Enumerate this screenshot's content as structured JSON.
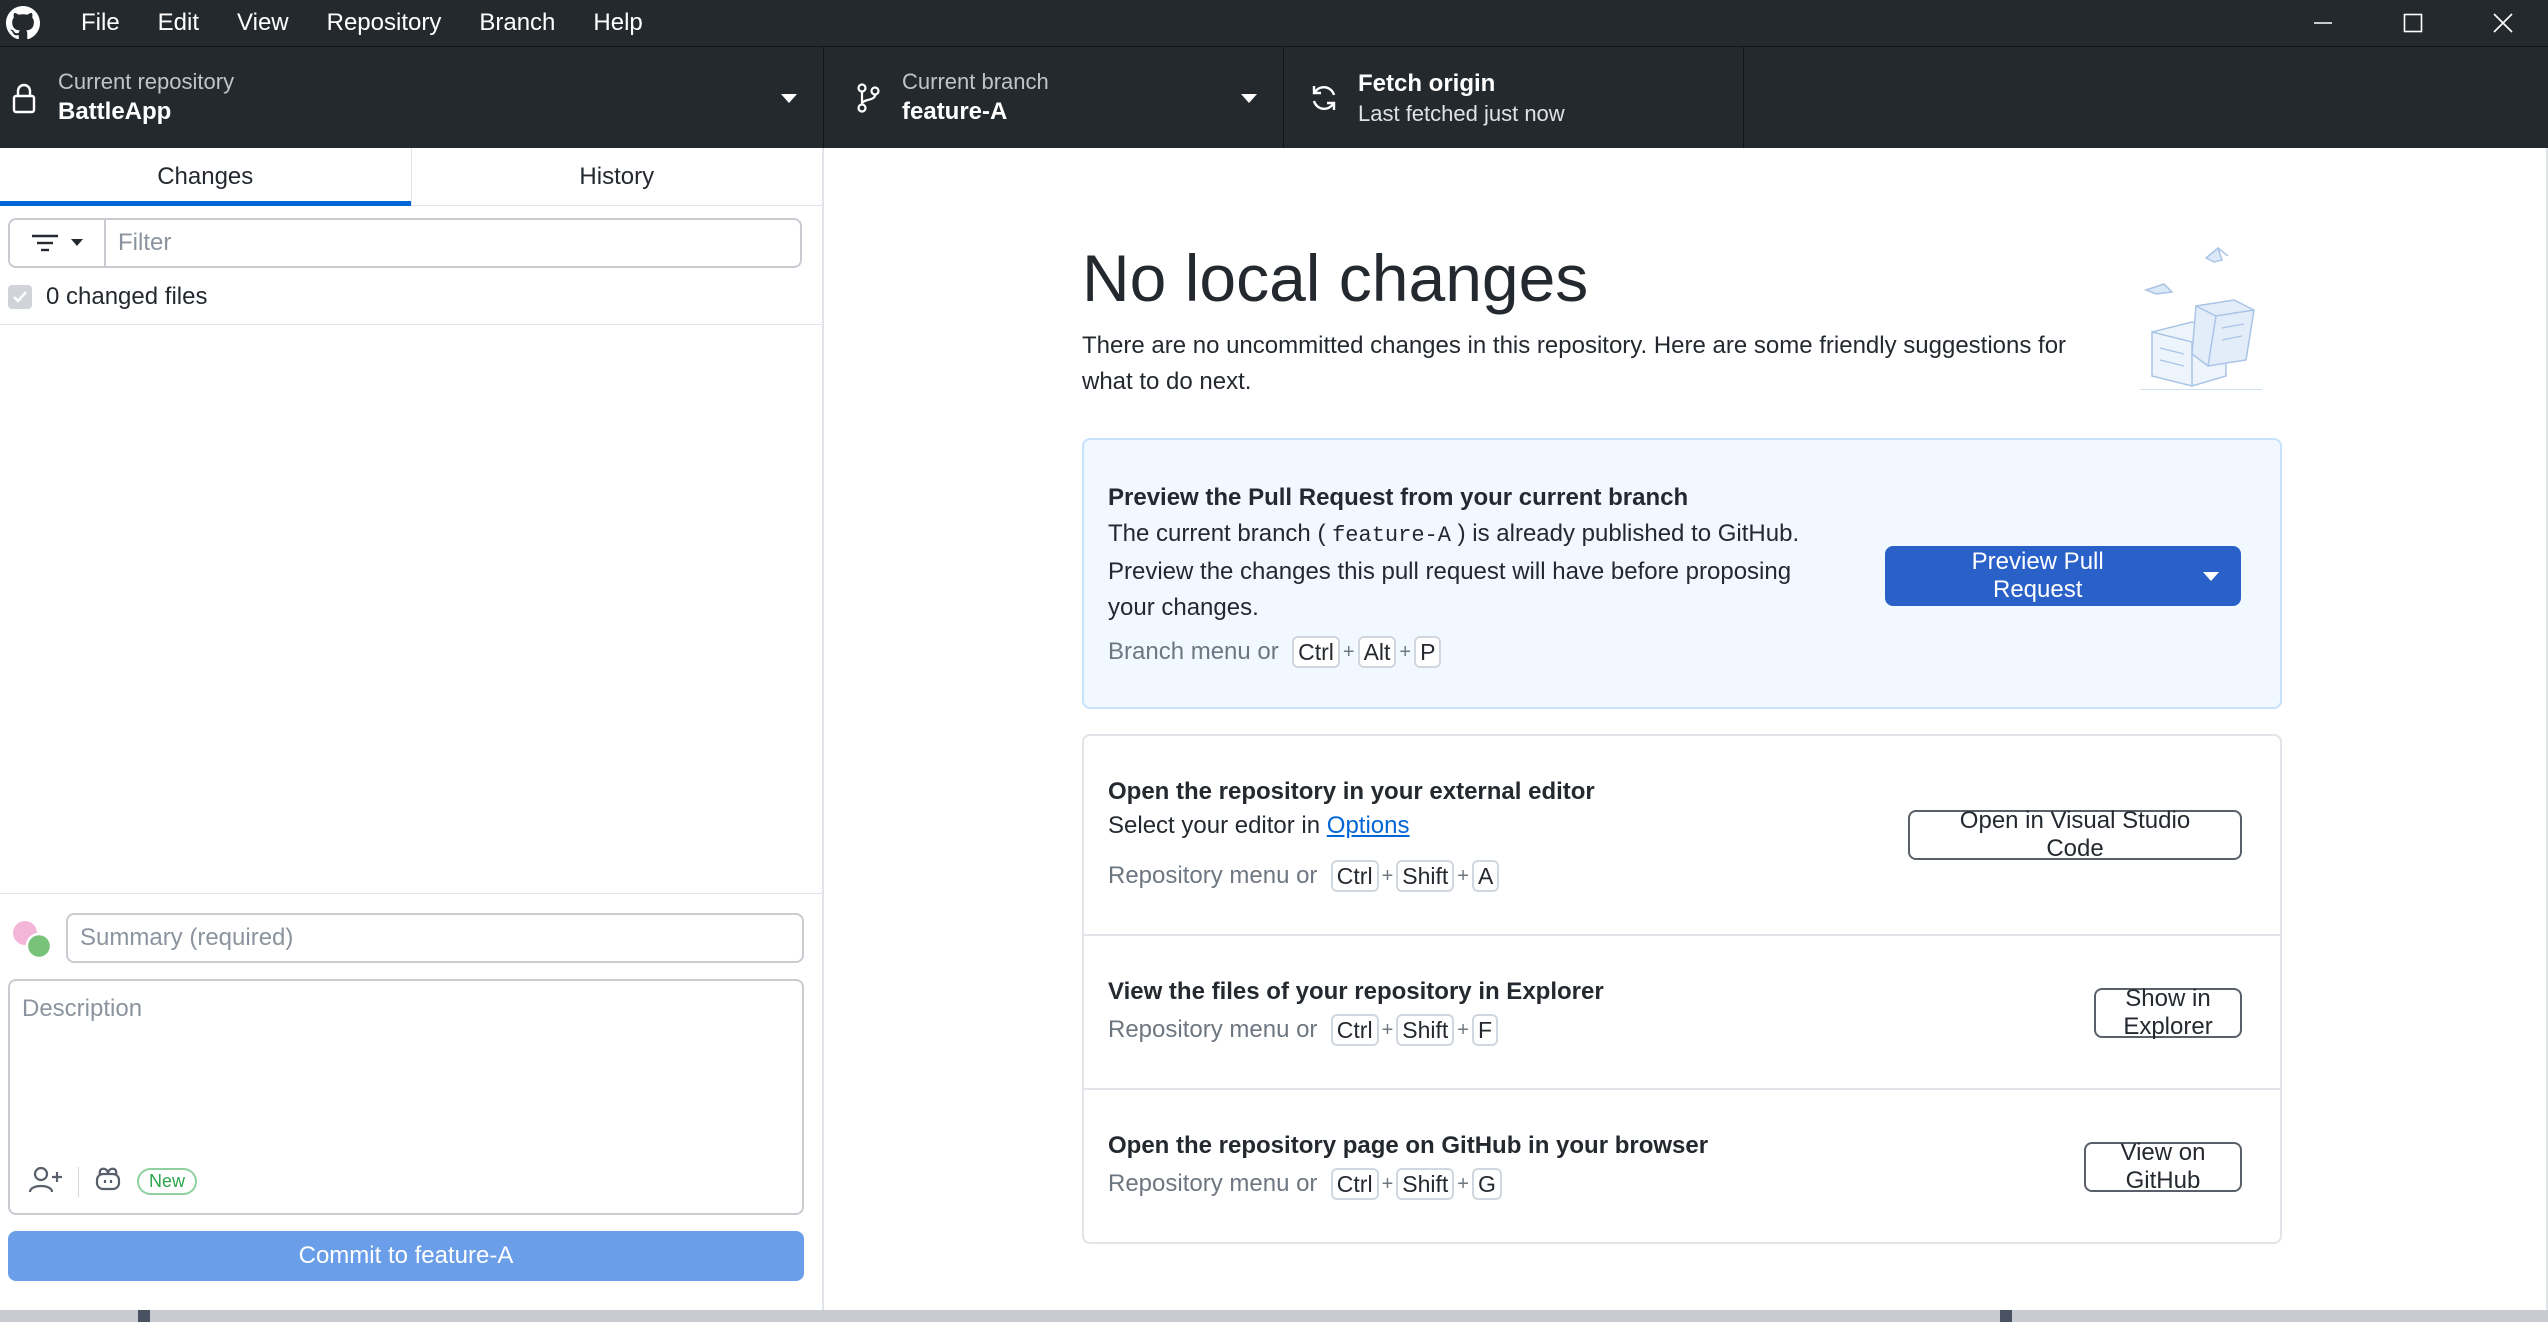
{
  "menu": [
    "File",
    "Edit",
    "View",
    "Repository",
    "Branch",
    "Help"
  ],
  "toolbar": {
    "repo_label": "Current repository",
    "repo_value": "BattleApp",
    "branch_label": "Current branch",
    "branch_value": "feature-A",
    "fetch_title": "Fetch origin",
    "fetch_sub": "Last fetched just now"
  },
  "left": {
    "tabs": [
      "Changes",
      "History"
    ],
    "filter_placeholder": "Filter",
    "changed_files": "0 changed files",
    "summary_placeholder": "Summary (required)",
    "description_placeholder": "Description",
    "new_badge": "New",
    "commit_button": "Commit to feature-A"
  },
  "main": {
    "title": "No local changes",
    "description": "There are no uncommitted changes in this repository. Here are some friendly suggestions for what to do next.",
    "pr": {
      "title": "Preview the Pull Request from your current branch",
      "line1_pre": "The current branch (",
      "branch": "feature-A",
      "line1_post": ") is already published to GitHub.",
      "line2": "Preview the changes this pull request will have before proposing your changes.",
      "hint_prefix": "Branch menu or",
      "keys": [
        "Ctrl",
        "Alt",
        "P"
      ],
      "button": "Preview Pull Request"
    },
    "editor": {
      "title": "Open the repository in your external editor",
      "body_pre": "Select your editor in",
      "link": "Options",
      "hint_prefix": "Repository menu or",
      "keys": [
        "Ctrl",
        "Shift",
        "A"
      ],
      "button": "Open in Visual Studio Code"
    },
    "explorer": {
      "title": "View the files of your repository in Explorer",
      "hint_prefix": "Repository menu or",
      "keys": [
        "Ctrl",
        "Shift",
        "F"
      ],
      "button": "Show in Explorer"
    },
    "github": {
      "title": "Open the repository page on GitHub in your browser",
      "hint_prefix": "Repository menu or",
      "keys": [
        "Ctrl",
        "Shift",
        "G"
      ],
      "button": "View on GitHub"
    },
    "plus": "+"
  },
  "colors": {
    "titlebar": "#24292e",
    "accent": "#2a61c9",
    "commit_button": "#6b9ee8",
    "featured_card": "#f1f8ff"
  }
}
